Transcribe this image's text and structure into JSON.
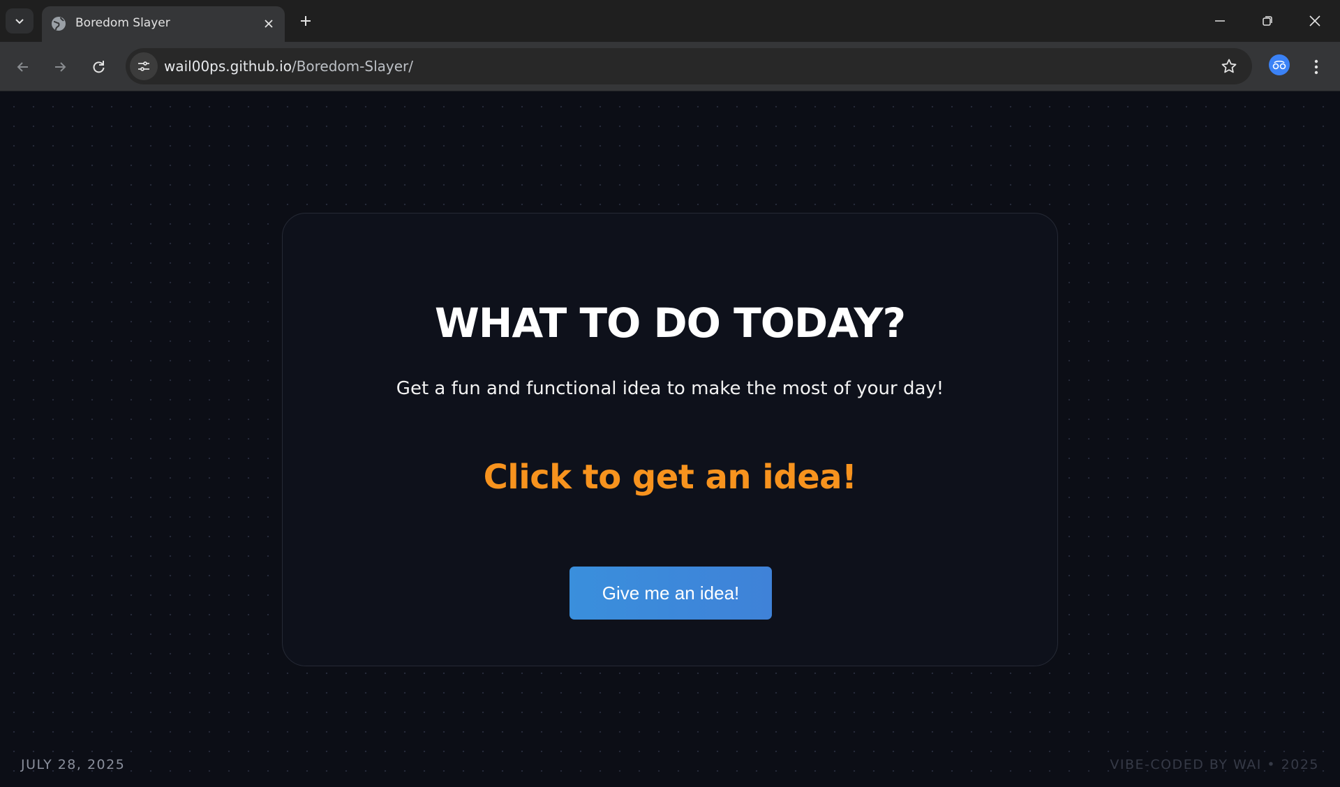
{
  "browser": {
    "tab_title": "Boredom Slayer",
    "url_host": "wail00ps.github.io",
    "url_path": "/Boredom-Slayer/",
    "icons": {
      "tab_search": "chevron-down-icon",
      "favicon": "globe-icon",
      "tab_close": "close-icon",
      "new_tab": "plus-icon",
      "minimize": "minimize-icon",
      "restore": "restore-icon",
      "close_window": "close-icon",
      "back": "arrow-left-icon",
      "forward": "arrow-right-icon",
      "reload": "reload-icon",
      "site_info": "tune-icon",
      "bookmark": "star-icon",
      "profile": "profile-icon",
      "menu": "kebab-menu-icon"
    }
  },
  "page": {
    "headline": "WHAT TO DO TODAY?",
    "subheadline": "Get a fun and functional idea to make the most of your day!",
    "idea_text": "Click to get an idea!",
    "button_label": "Give me an idea!",
    "footer_date": "JULY 28, 2025",
    "footer_credit": "VIBE-CODED BY WAI • 2025"
  },
  "colors": {
    "background": "#0c0e16",
    "card": "#0e111b",
    "accent_orange": "#f7931e",
    "button_blue": "#3a8fdc",
    "chrome_dark": "#1f1f1f",
    "chrome_toolbar": "#353638"
  }
}
